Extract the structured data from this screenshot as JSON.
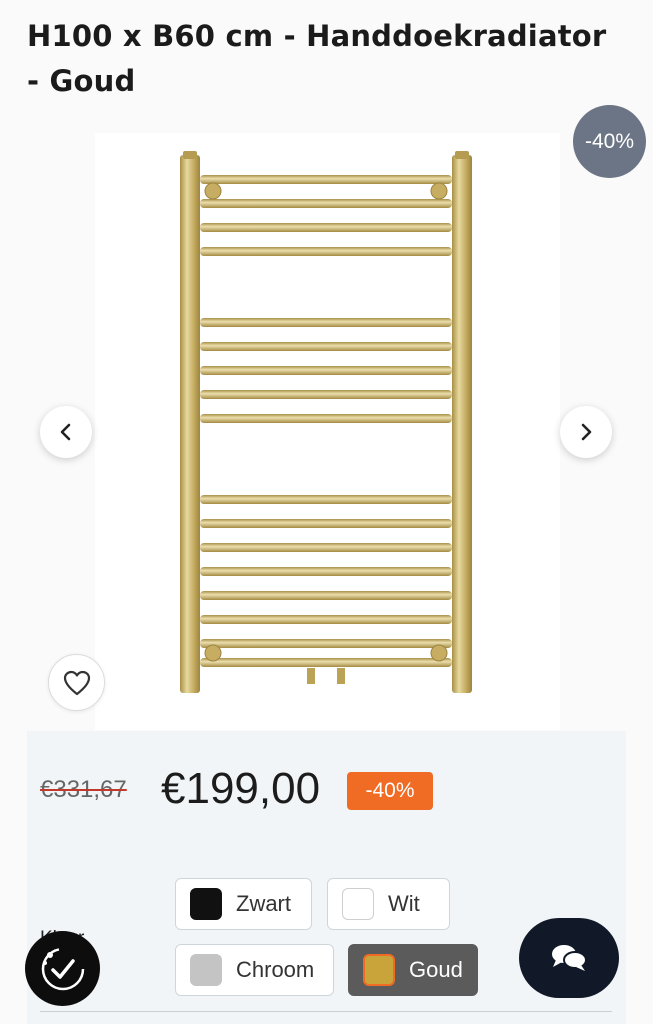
{
  "product": {
    "title": "H100 x B60 cm - Handdoekradiator - Goud",
    "discount_label": "-40%"
  },
  "price": {
    "old": "€331,67",
    "new": "€199,00",
    "badge": "-40%"
  },
  "colors": {
    "label": "Kleur",
    "options": [
      {
        "label": "Zwart",
        "swatch": "#111111",
        "selected": false
      },
      {
        "label": "Wit",
        "swatch": "#ffffff",
        "selected": false
      },
      {
        "label": "Chroom",
        "swatch": "#c4c4c4",
        "selected": false
      },
      {
        "label": "Goud",
        "swatch": "#c9a43b",
        "selected": true
      }
    ]
  },
  "icons": {
    "prev": "chevron-left-icon",
    "next": "chevron-right-icon",
    "favorite": "heart-icon",
    "chat": "chat-bubbles-icon",
    "reviews": "verified-check-icon"
  },
  "theme": {
    "accent": "#f06b24",
    "badge_grey": "#6c7585",
    "selected_bg": "#5b5b5b",
    "radiator_gold": "#c9b46a"
  }
}
